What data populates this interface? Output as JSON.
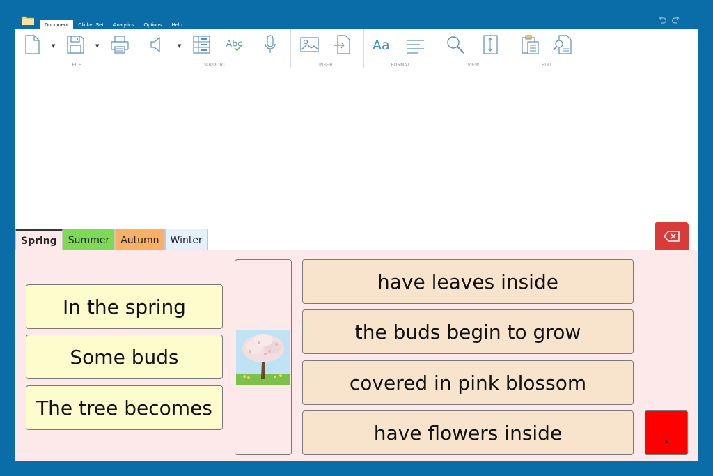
{
  "menu": {
    "tabs": [
      {
        "label": "Document"
      },
      {
        "label": "Clicker Set"
      },
      {
        "label": "Analytics"
      },
      {
        "label": "Options"
      },
      {
        "label": "Help"
      }
    ]
  },
  "ribbon": {
    "groups": {
      "file": "FILE",
      "support": "SUPPORT",
      "insert": "INSERT",
      "format": "FORMAT",
      "view": "VIEW",
      "edit": "EDIT"
    },
    "format_font_glyph": "Aa",
    "spell_glyph": "Abc"
  },
  "set_tabs": [
    {
      "label": "Spring"
    },
    {
      "label": "Summer"
    },
    {
      "label": "Autumn"
    },
    {
      "label": "Winter"
    }
  ],
  "grid": {
    "left_cells": [
      "In the spring",
      "Some buds",
      "The tree becomes"
    ],
    "right_cells": [
      "have leaves inside",
      "the buds begin to grow",
      "covered in pink blossom",
      "have flowers inside"
    ],
    "period": "."
  },
  "colors": {
    "background": "#0a6da8",
    "grid_background": "#fde9ea",
    "left_cell": "#fefccc",
    "right_cell": "#f8e3cd",
    "backspace": "#d93b3b",
    "period_cell": "#ff0000",
    "tab_summer": "#7ed957",
    "tab_autumn": "#f7b066",
    "tab_winter": "#e4f0fb",
    "icon_blue": "#3d8fd1"
  },
  "icons": {
    "app": "folder-icon",
    "undo": "undo-icon",
    "redo": "redo-icon",
    "backspace": "backspace-icon",
    "picture": "blossom-tree-image"
  }
}
